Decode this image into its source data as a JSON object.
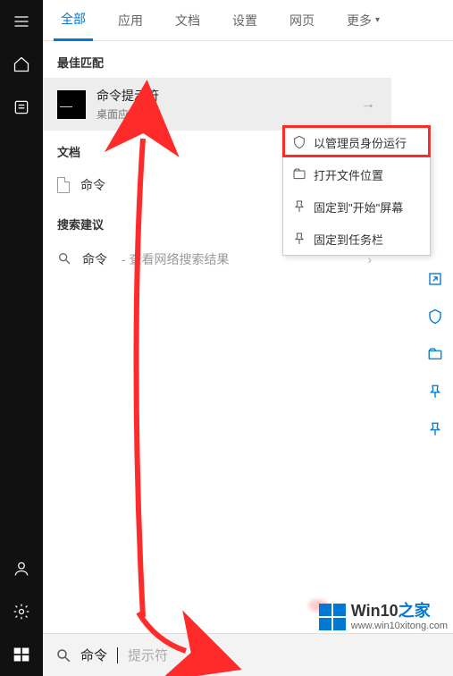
{
  "tabs": {
    "all": "全部",
    "apps": "应用",
    "docs": "文档",
    "settings": "设置",
    "web": "网页",
    "more": "更多"
  },
  "sections": {
    "best_match": "最佳匹配",
    "documents": "文档",
    "suggestions": "搜索建议"
  },
  "best_match": {
    "title": "命令提示符",
    "subtitle": "桌面应用"
  },
  "documents": {
    "item1": "命令"
  },
  "suggestions": {
    "term": "命令",
    "desc": " - 查看网络搜索结果"
  },
  "context_menu": {
    "run_admin": "以管理员身份运行",
    "open_location": "打开文件位置",
    "pin_start": "固定到\"开始\"屏幕",
    "pin_taskbar": "固定到任务栏"
  },
  "search": {
    "typed": "命令",
    "ghost": "提示符"
  },
  "watermark": {
    "brand_main": "Win10",
    "brand_suffix": "之家",
    "url": "www.win10xitong.com"
  }
}
